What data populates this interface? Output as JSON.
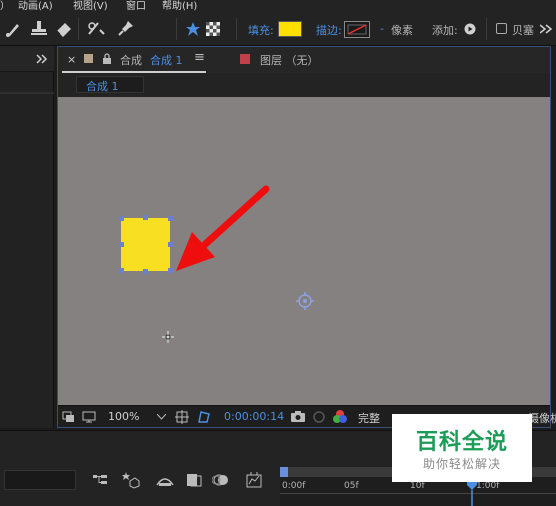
{
  "menu": {
    "items": [
      "动画(A)",
      "视图(V)",
      "窗口",
      "帮助(H)"
    ],
    "leading": "）"
  },
  "toolbar": {
    "fill_label": "填充:",
    "stroke_label": "描边:",
    "stroke_units": "像素",
    "add_label": "添加:",
    "bezier_label": "贝塞",
    "fill_color": "#ffe000",
    "stroke_dash": "-"
  },
  "composition": {
    "tab_label": "合成",
    "tab_name": "合成 1",
    "layer_label": "图层 （无）",
    "subtab_label": "合成 1"
  },
  "viewer": {
    "background_color": "#858181",
    "shape_color": "#f9df22",
    "arrow_color": "#ee0e0e"
  },
  "viewer_bar": {
    "zoom": "100%",
    "timecode": "0:00:00:14",
    "quality": "完整",
    "camera_label": "摄像机"
  },
  "timeline": {
    "ticks": [
      "0:00f",
      "05f",
      "10f",
      "1:00f"
    ]
  },
  "watermark": {
    "main": "百科全说",
    "sub": "助你轻松解决"
  }
}
